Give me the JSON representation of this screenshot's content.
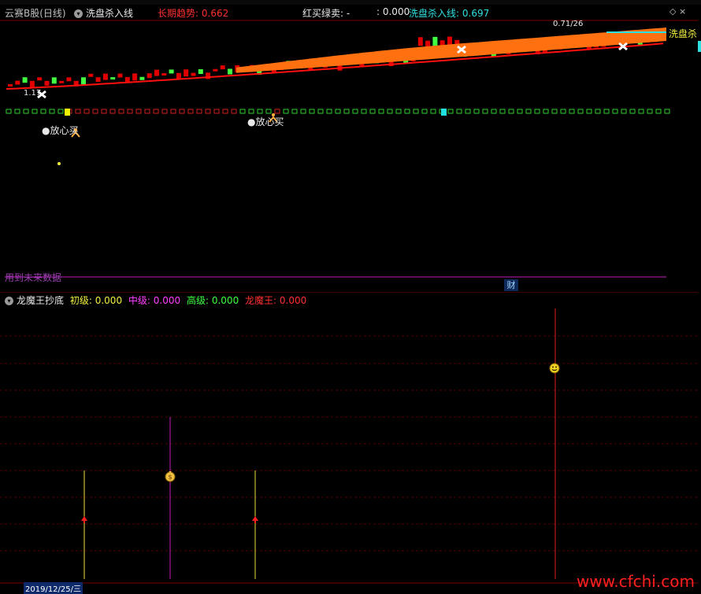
{
  "main_panel": {
    "stock_name": "云赛B股",
    "period": "(日线)",
    "indicator_name": "洗盘杀入线",
    "long_trend_label": "长期趋势:",
    "long_trend_value": "0.662",
    "red_buy_green_sell_label": "红买绿卖:",
    "red_buy_green_sell_value": "-",
    "unnamed_value": ": 0.000",
    "washout_label": "洗盘杀入线:",
    "washout_value": "0.697",
    "price_tag_1": "0.71/26",
    "price_tag_2": "1.17",
    "signal_label_1": "●放心买",
    "signal_label_2": "●放心买",
    "right_label": "洗盘杀",
    "future_data_text": "用到未来数据",
    "cai_badge": "财"
  },
  "lower_panel": {
    "indicator_name": "龙魔王抄底",
    "level1_label": "初级:",
    "level1_value": "0.000",
    "level2_label": "中级:",
    "level2_value": "0.000",
    "level3_label": "高级:",
    "level3_value": "0.000",
    "level4_label": "龙魔王:",
    "level4_value": "0.000"
  },
  "footer": {
    "date": "2019/12/25/三",
    "watermark": "www.cfchi.com"
  },
  "colors": {
    "up_candle": "#e00000",
    "down_candle": "#40ff40",
    "band": "#ff7010",
    "trend_line": "#ff0000",
    "washout_line": "#2fe0e0",
    "magenta_line": "#c020c0",
    "yellow_bar": "#f0e040"
  },
  "icons": [
    "dropdown-icon",
    "cross-marker-icon",
    "smiley-icon",
    "money-bag-icon",
    "up-arrow-icon",
    "person-icon"
  ]
}
